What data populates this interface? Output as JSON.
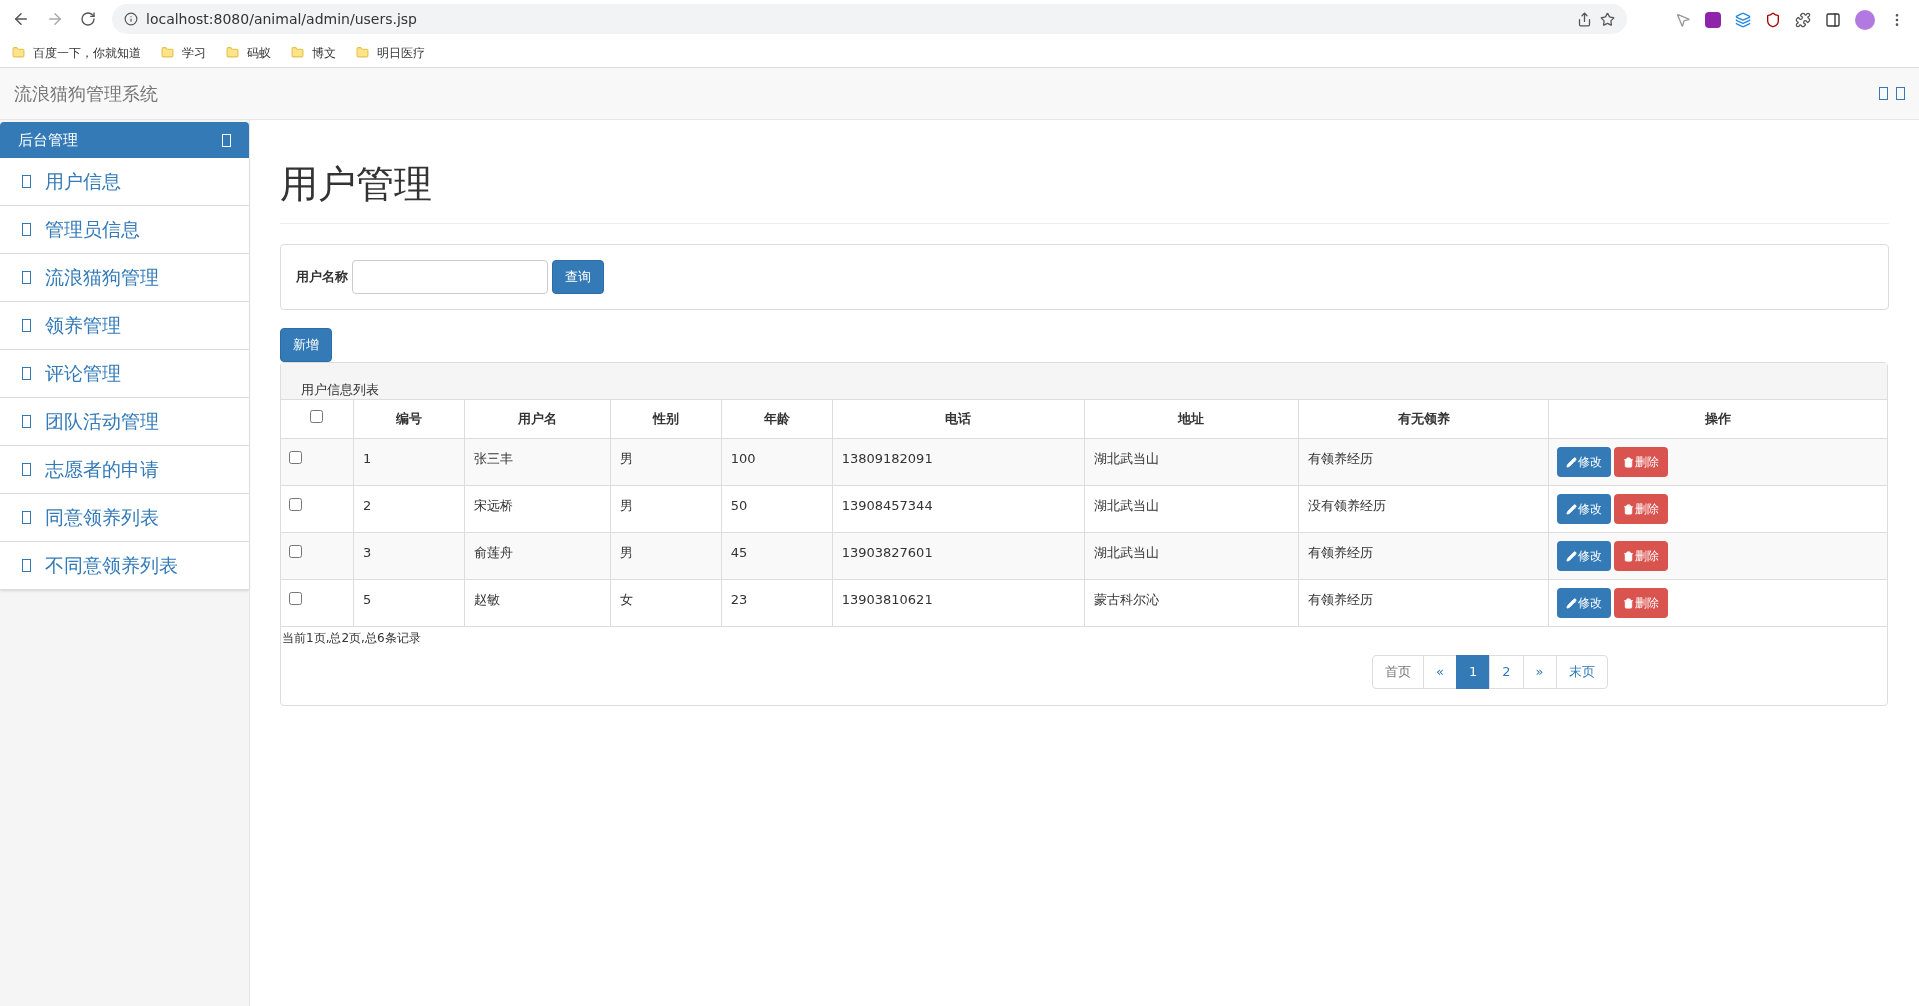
{
  "browser": {
    "url": "localhost:8080/animal/admin/users.jsp",
    "bookmarks": [
      "百度一下，你就知道",
      "学习",
      "码蚁",
      "博文",
      "明日医疗"
    ]
  },
  "navbar": {
    "title": "流浪猫狗管理系统"
  },
  "sidebar": {
    "header": "后台管理",
    "items": [
      {
        "label": "用户信息"
      },
      {
        "label": "管理员信息"
      },
      {
        "label": "流浪猫狗管理"
      },
      {
        "label": "领养管理"
      },
      {
        "label": "评论管理"
      },
      {
        "label": "团队活动管理"
      },
      {
        "label": "志愿者的申请"
      },
      {
        "label": "同意领养列表"
      },
      {
        "label": "不同意领养列表"
      }
    ]
  },
  "page_title": "用户管理",
  "search": {
    "label": "用户名称",
    "button": "查询"
  },
  "add_button": "新增",
  "table": {
    "caption": "用户信息列表",
    "select_all": {
      "checked": false
    },
    "columns": [
      "编号",
      "用户名",
      "性别",
      "年龄",
      "电话",
      "地址",
      "有无领养",
      "操作"
    ],
    "rows": [
      {
        "checked": false,
        "cells": [
          "1",
          "张三丰",
          "男",
          "100",
          "13809182091",
          "湖北武当山",
          "有领养经历"
        ],
        "actions": [
          "修改",
          "删除"
        ]
      },
      {
        "checked": false,
        "cells": [
          "2",
          "宋远桥",
          "男",
          "50",
          "13908457344",
          "湖北武当山",
          "没有领养经历"
        ],
        "actions": [
          "修改",
          "删除"
        ]
      },
      {
        "checked": false,
        "cells": [
          "3",
          "俞莲舟",
          "男",
          "45",
          "13903827601",
          "湖北武当山",
          "有领养经历"
        ],
        "actions": [
          "修改",
          "删除"
        ]
      },
      {
        "checked": false,
        "cells": [
          "5",
          "赵敏",
          "女",
          "23",
          "13903810621",
          "蒙古科尔沁",
          "有领养经历"
        ],
        "actions": [
          "修改",
          "删除"
        ]
      }
    ]
  },
  "summary": "当前1页,总2页,总6条记录",
  "pagination": [
    {
      "label": "首页",
      "selected": false
    },
    {
      "label": "«",
      "selected": false
    },
    {
      "label": "1",
      "selected": true
    },
    {
      "label": "2",
      "selected": false
    },
    {
      "label": "»",
      "selected": false
    },
    {
      "label": "末页",
      "selected": false
    }
  ]
}
